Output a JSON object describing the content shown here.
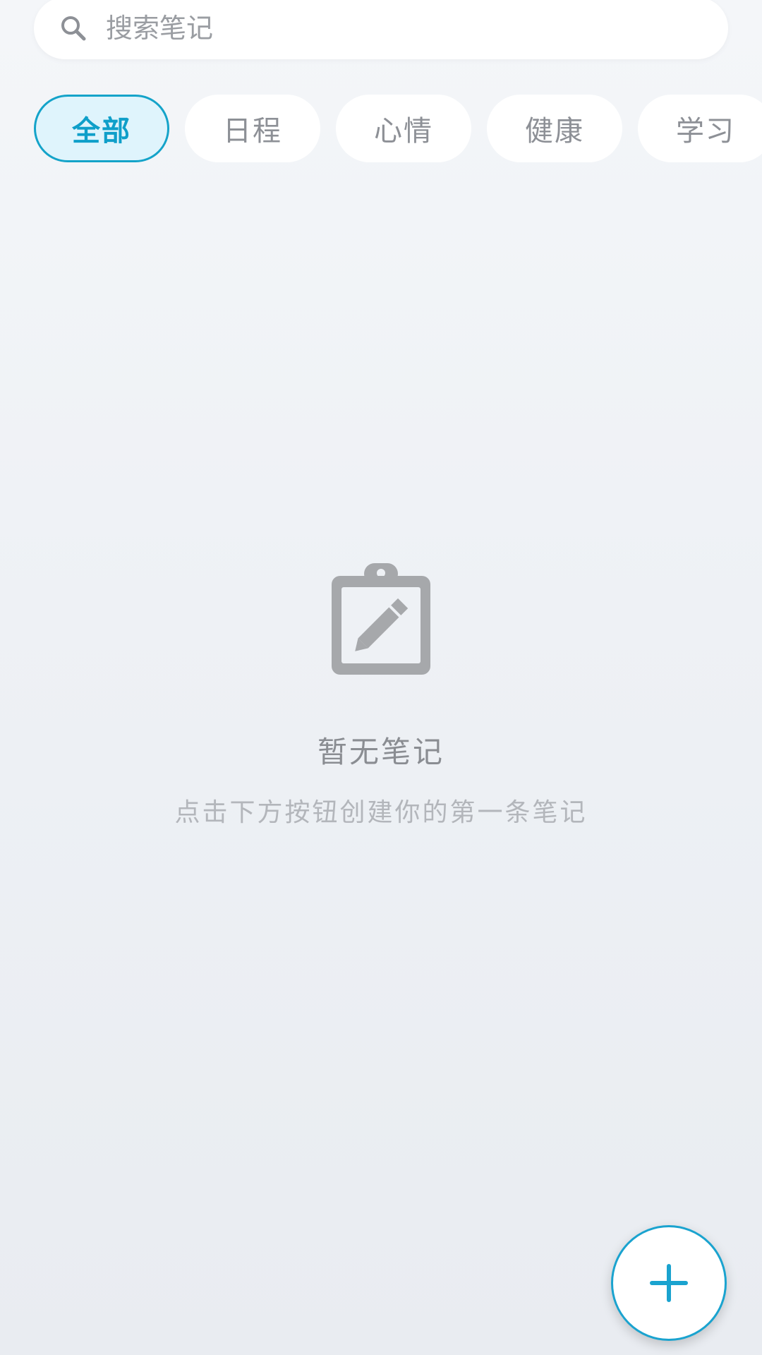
{
  "search": {
    "placeholder": "搜索笔记",
    "icon": "search-icon"
  },
  "categories": {
    "items": [
      {
        "label": "全部",
        "active": true
      },
      {
        "label": "日程",
        "active": false
      },
      {
        "label": "心情",
        "active": false
      },
      {
        "label": "健康",
        "active": false
      },
      {
        "label": "学习",
        "active": false
      }
    ]
  },
  "empty_state": {
    "icon": "clipboard-edit-icon",
    "title": "暂无笔记",
    "subtitle": "点击下方按钮创建你的第一条笔记"
  },
  "fab": {
    "icon": "plus-icon"
  },
  "colors": {
    "accent": "#14a3c9",
    "active_chip_bg": "#dff4fc",
    "icon_gray": "#a6a8ab"
  }
}
